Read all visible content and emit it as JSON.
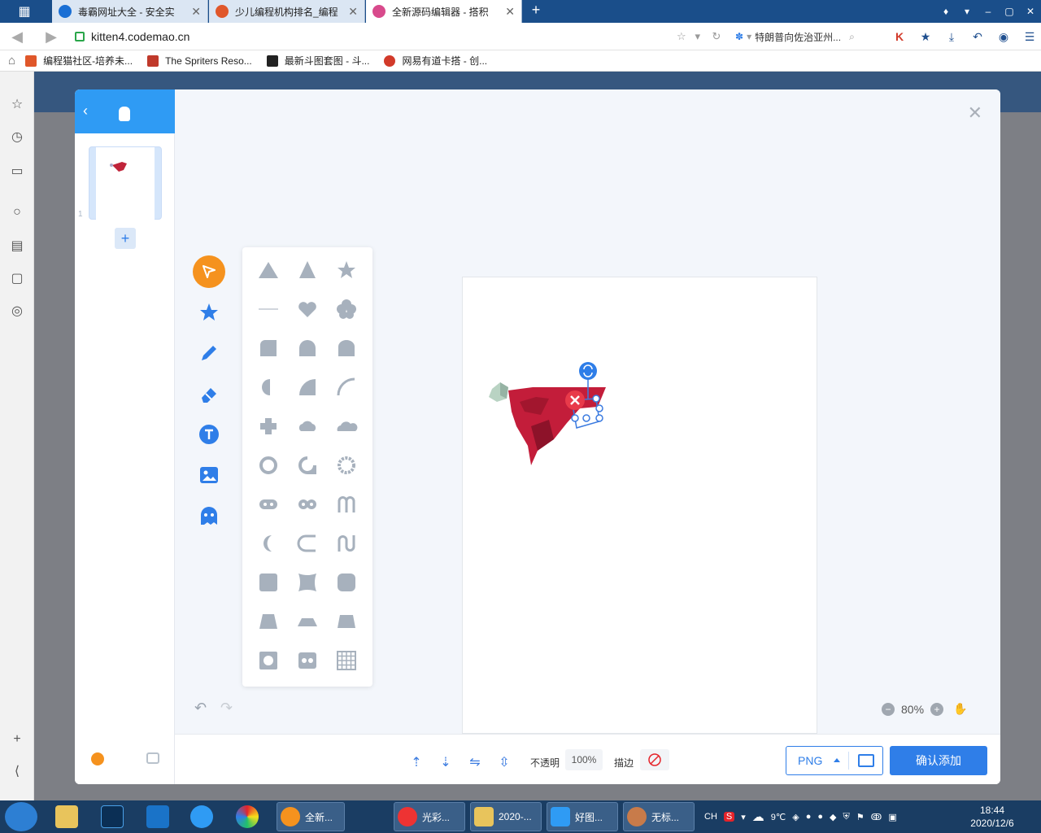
{
  "browser": {
    "tabs": [
      {
        "label": "毒霸网址大全 - 安全实",
        "color": "#1a6fd4"
      },
      {
        "label": "少儿编程机构排名_编程",
        "color": "#e0572a"
      },
      {
        "label": "全新源码编辑器 - 搭积",
        "color": "#d84a8c"
      }
    ],
    "url": "kitten4.codemao.cn",
    "search_text": "特朗普向佐治亚州...",
    "bookmarks": [
      {
        "label": "编程猫社区-培养未...",
        "color": "#e0572a"
      },
      {
        "label": "The Spriters Reso...",
        "color": "#c0392b"
      },
      {
        "label": "最新斗图套图 - 斗...",
        "color": "#222222"
      },
      {
        "label": "网易有道卡搭 - 创...",
        "color": "#d23a2a"
      }
    ]
  },
  "editor": {
    "costume_index": "1",
    "add_label": "+",
    "zoom": "80%",
    "opacity_label": "不透明",
    "opacity_value": "100%",
    "stroke_label": "描边",
    "format": "PNG",
    "confirm_label": "确认添加",
    "palette_colors": [
      "#e5232a",
      "#f57a1e",
      "#f7e01a",
      "#22c06a",
      "#6fd3f7",
      "#2f7ee8",
      "#6b5bd6",
      "#444444"
    ]
  },
  "taskbar": {
    "tasks": [
      {
        "label": "全新...",
        "color": "#f5921e"
      },
      {
        "label": "光彩...",
        "color": "#e33"
      },
      {
        "label": "2020-...",
        "color": "#e8c45c"
      },
      {
        "label": "好图...",
        "color": "#2f9bf4"
      },
      {
        "label": "无标...",
        "color": "#c87b4a"
      }
    ],
    "lang": "CH",
    "temp": "9℃",
    "time": "18:44",
    "date": "2020/12/6"
  }
}
